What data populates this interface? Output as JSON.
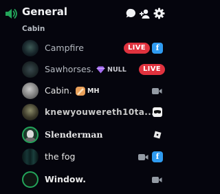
{
  "channel": {
    "name": "General",
    "subtitle": "Cabin",
    "icon": "speaker-icon",
    "actions": [
      "chat-bubble-icon",
      "add-user-icon",
      "gear-icon"
    ]
  },
  "members": [
    {
      "name": "Campfire",
      "live": "LIVE",
      "activity_icon": "f-badge-icon",
      "activity_letter": "f"
    },
    {
      "name": "Sawhorses.",
      "tag": "NULL",
      "tag_icon": "gem-icon",
      "live": "LIVE"
    },
    {
      "name": "Cabin.",
      "tag": "MH",
      "tag_icon": "orange-stripe-icon",
      "activity_icon": "video-camera-icon"
    },
    {
      "name": "knewyouwereth10ta...",
      "activity_icon": "mask-icon"
    },
    {
      "name": "Slenderman",
      "activity_icon": "roblox-icon"
    },
    {
      "name": "the fog",
      "activity_icon": "video-camera-icon",
      "activity_icon_2": "f-badge-icon",
      "activity_letter": "f"
    },
    {
      "name": "Window.",
      "activity_icon": "video-camera-icon"
    }
  ],
  "colors": {
    "background": "#05050d",
    "live_red": "#e0323e",
    "badge_blue": "#2f9bf0",
    "speaking_green": "#23a55a"
  }
}
